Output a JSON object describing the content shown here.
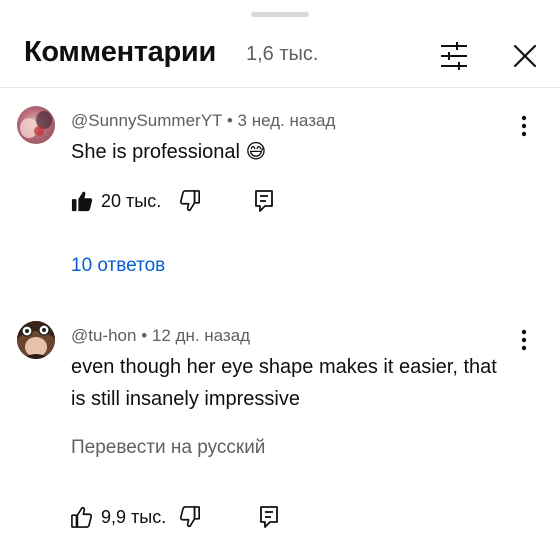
{
  "header": {
    "title": "Комментарии",
    "count": "1,6 тыс.",
    "filter_icon": "sliders-icon",
    "close_icon": "close-icon"
  },
  "comments": [
    {
      "author": "@SunnySummerYT",
      "separator": "•",
      "time": "3 нед. назад",
      "text": "She is professional 😅",
      "likes": "20 тыс.",
      "liked": true,
      "replies_label": "10 ответов"
    },
    {
      "author": "@tu-hon",
      "separator": "•",
      "time": "12 дн. назад",
      "text": "even though her eye shape makes it easier, that is still insanely impressive",
      "translate_label": "Перевести на русский",
      "likes": "9,9 тыс.",
      "liked": false
    }
  ],
  "colors": {
    "link": "#065fd4",
    "secondary_text": "#606060",
    "primary_text": "#0f0f0f"
  }
}
